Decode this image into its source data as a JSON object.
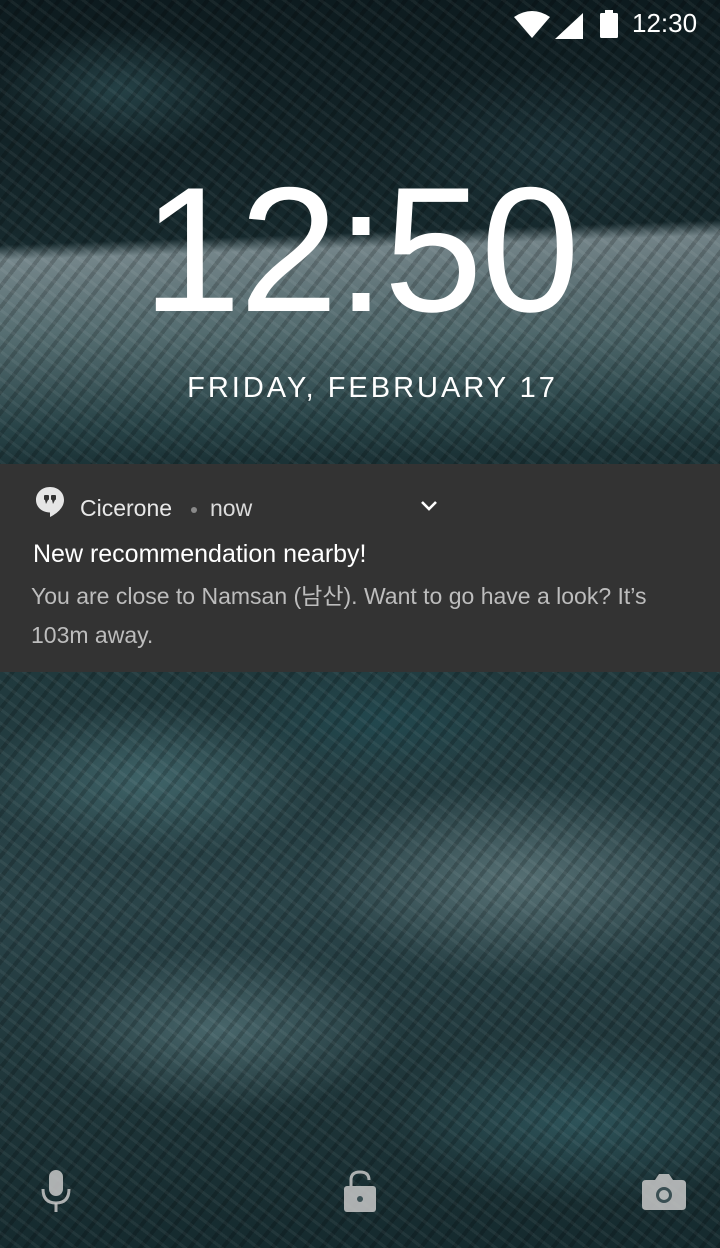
{
  "status_bar": {
    "time": "12:30",
    "icons": [
      "wifi-icon",
      "signal-icon",
      "battery-icon"
    ]
  },
  "lock_screen": {
    "clock": "12:50",
    "date": "FRIDAY, FEBRUARY 17"
  },
  "notification": {
    "app_name": "Cicerone",
    "time": "now",
    "title": "New recommendation nearby!",
    "body": "You are close to Namsan (남산). Want to go have a look? It’s 103m away.",
    "icon": "quote-bubble-icon",
    "expand_icon": "chevron-down-icon",
    "background_color": "#333333"
  },
  "bottom_bar": {
    "left_icon": "mic-icon",
    "center_icon": "lock-icon",
    "right_icon": "camera-icon"
  }
}
